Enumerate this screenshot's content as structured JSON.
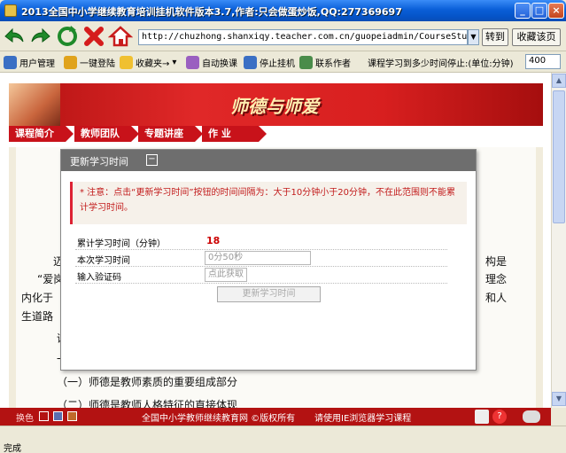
{
  "window": {
    "title": "2013全国中小学继续教育培训挂机软件版本3.7,作者:只会做蛋炒饭,QQ:277369697"
  },
  "toolbar": {
    "url": "http://chuzhong.shanxiqy.teacher.com.cn/guopeiadmin/CourseStudy/Stu",
    "go_label": "转到",
    "favorite_page_label": "收藏该页"
  },
  "toolbar2": {
    "user_manage": "用户管理",
    "one_key_login": "一键登陆",
    "favorites": "收藏夹→",
    "auto_switch": "自动换课",
    "stop_hangup": "停止挂机",
    "contact_author": "联系作者",
    "stop_label": "课程学习到多少时间停止:(单位:分钟)",
    "stop_value": "400"
  },
  "banner": {
    "title": "师德与师爱"
  },
  "tabs": [
    "课程简介",
    "教师团队",
    "专题讲座",
    "作 业"
  ],
  "article": {
    "p_left1": "迈",
    "p_right1": "构是",
    "p_left2": "“爱岗",
    "p_right2": "理念",
    "p_left3": "内化于",
    "p_right3": "和人",
    "p_left4": "生道路",
    "p_left5": "课",
    "p_left6": "一",
    "line_a": "（一）师德是教师素质的重要组成部分",
    "line_b": "（二）师德是教师人格特征的直接体现"
  },
  "modal": {
    "title": "更新学习时间",
    "collapse": "−",
    "notice": "* 注意：点击“更新学习时间”按钮的时间间隔为：大于10分钟小于20分钟，不在此范围则不能累计学习时间。",
    "fields": {
      "total_label": "累计学习时间（分钟）",
      "total_value": "18",
      "session_label": "本次学习时间",
      "session_value": "0分50秒",
      "captcha_label": "输入验证码",
      "captcha_placeholder": "点此获取"
    },
    "submit_label": "更新学习时间"
  },
  "footer": {
    "skin_label": "换色",
    "copyright": "全国中小学教师继续教育网 ©版权所有",
    "browser_hint": "请使用IE浏览器学习课程"
  },
  "status": {
    "text": "完成"
  },
  "colors": {
    "accent_red": "#c8121a",
    "titlebar_blue": "#0a5fd8"
  }
}
